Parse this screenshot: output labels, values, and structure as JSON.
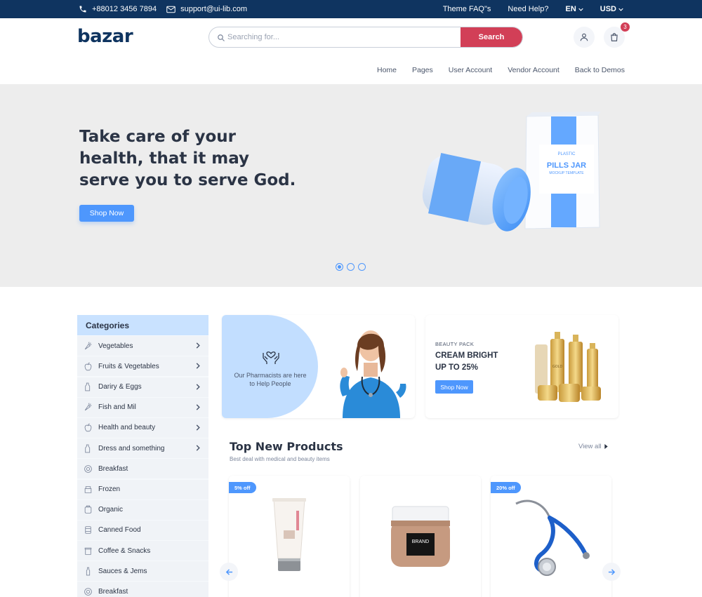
{
  "topbar": {
    "phone": "+88012 3456 7894",
    "email": "support@ui-lib.com",
    "faq": "Theme FAQ\"s",
    "help": "Need Help?",
    "language": "EN",
    "currency": "USD"
  },
  "header": {
    "logo": "bazar",
    "search_placeholder": "Searching for...",
    "search_button": "Search",
    "cart_count": "3"
  },
  "nav": [
    "Home",
    "Pages",
    "User Account",
    "Vendor Account",
    "Back to Demos"
  ],
  "hero": {
    "title": "Take care of your health, that it may serve you to serve God.",
    "button": "Shop Now",
    "product_label_top": "PLASTIC",
    "product_label_main": "PILLS JAR",
    "product_label_sub": "MOCKUP TEMPLATE",
    "slides": 3,
    "active_slide": 1
  },
  "categories": {
    "title": "Categories",
    "items": [
      {
        "label": "Vegetables",
        "icon": "carrot-icon",
        "has_sub": true
      },
      {
        "label": "Fruits & Vegetables",
        "icon": "apple-icon",
        "has_sub": true
      },
      {
        "label": "Dariry & Eggs",
        "icon": "milk-icon",
        "has_sub": true
      },
      {
        "label": "Fish and Mil",
        "icon": "carrot-icon",
        "has_sub": true
      },
      {
        "label": "Health and beauty",
        "icon": "apple-icon",
        "has_sub": true
      },
      {
        "label": "Dress and something",
        "icon": "milk-icon",
        "has_sub": true
      },
      {
        "label": "Breakfast",
        "icon": "breakfast-icon",
        "has_sub": false
      },
      {
        "label": "Frozen",
        "icon": "frozen-icon",
        "has_sub": false
      },
      {
        "label": "Organic",
        "icon": "organic-icon",
        "has_sub": false
      },
      {
        "label": "Canned Food",
        "icon": "can-icon",
        "has_sub": false
      },
      {
        "label": "Coffee & Snacks",
        "icon": "coffee-icon",
        "has_sub": false
      },
      {
        "label": "Sauces & Jems",
        "icon": "sauce-icon",
        "has_sub": false
      },
      {
        "label": "Breakfast",
        "icon": "breakfast-icon",
        "has_sub": false
      }
    ]
  },
  "promo_pharmacist": {
    "text": "Our Pharmacists are here to Help People"
  },
  "promo_beauty": {
    "kicker": "BEAUTY PACK",
    "title_line1": "CREAM BRIGHT",
    "title_line2": "UP TO 25%",
    "button": "Shop Now",
    "product_label": "GOLD"
  },
  "products": {
    "title": "Top New Products",
    "subtitle": "Best deal with medical and beauty items",
    "view_all": "View all",
    "items": [
      {
        "discount": "5% off",
        "image": "cream-tube"
      },
      {
        "discount": "",
        "image": "cosmetic-jar",
        "label": "BRAND"
      },
      {
        "discount": "20% off",
        "image": "stethoscope"
      }
    ]
  },
  "colors": {
    "navy": "#0f3460",
    "accent_red": "#d23f57",
    "primary_blue": "#4e97fd",
    "category_header": "#c9e2ff",
    "hero_bg": "#ededed"
  }
}
